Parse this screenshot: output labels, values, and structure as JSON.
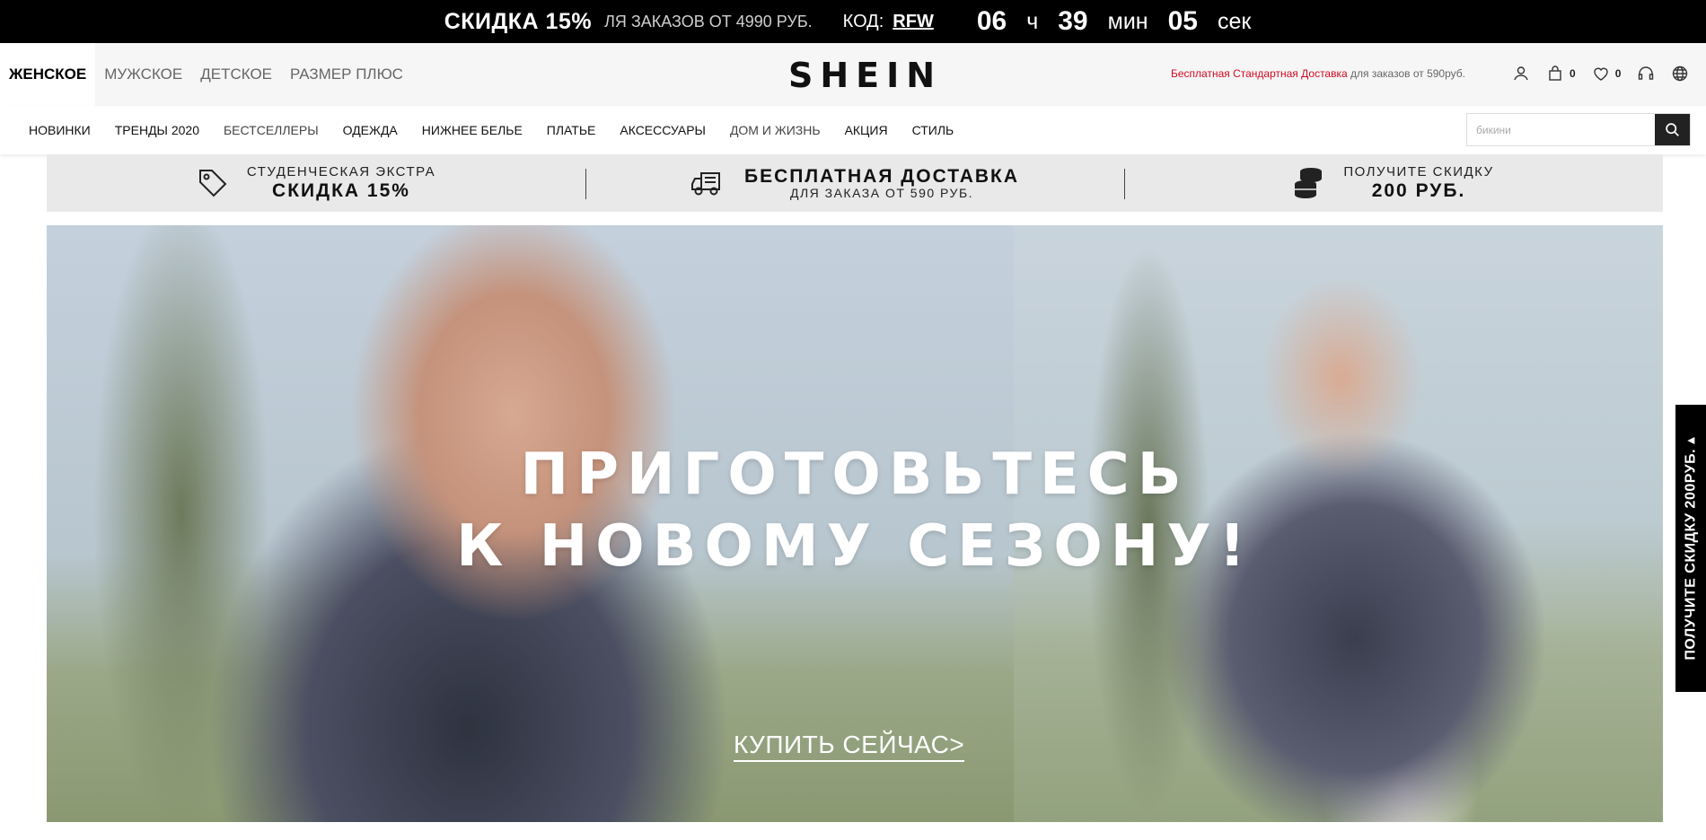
{
  "promo": {
    "discount": "СКИДКА 15%",
    "sub": "ЛЯ ЗАКАЗОВ ОТ 4990 РУБ.",
    "code_label": "КОД:",
    "code": "RFW",
    "hours": "06",
    "hours_unit": "ч",
    "minutes": "39",
    "minutes_unit": "мин",
    "seconds": "05",
    "seconds_unit": "сек"
  },
  "header": {
    "gender_tabs": [
      "ЖЕНСКОЕ",
      "МУЖСКОЕ",
      "ДЕТСКОЕ",
      "РАЗМЕР ПЛЮС"
    ],
    "logo": "SHEIN",
    "shipping_red": "Бесплатная Стандартная Доставка",
    "shipping_rest": "для заказов от 590руб.",
    "cart_count": "0",
    "wishlist_count": "0"
  },
  "nav": {
    "items": [
      "НОВИНКИ",
      "ТРЕНДЫ 2020",
      "БЕСТСЕЛЛЕРЫ",
      "ОДЕЖДА",
      "НИЖНЕЕ БЕЛЬЕ",
      "ПЛАТЬЕ",
      "АКСЕССУАРЫ",
      "ДОМ И ЖИЗНЬ",
      "АКЦИЯ",
      "СТИЛЬ"
    ],
    "search_placeholder": "бикини"
  },
  "benefits": [
    {
      "small": "СТУДЕНЧЕСКАЯ ЭКСТРА",
      "big": "СКИДКА 15%"
    },
    {
      "big": "БЕСПЛАТНАЯ ДОСТАВКА",
      "small": "ДЛЯ ЗАКАЗА ОТ 590 РУБ."
    },
    {
      "small": "ПОЛУЧИТЕ СКИДКУ",
      "big": "200 РУБ."
    }
  ],
  "hero": {
    "title_line1": "ПРИГОТОВЬТЕСЬ",
    "title_line2": "К НОВОМУ СЕЗОНУ!",
    "cta": "КУПИТЬ СЕЙЧАС>"
  },
  "side_tab": {
    "label": "ПОЛУЧИТЕ СКИДКУ 200РУБ. ▴"
  },
  "colors": {
    "accent_red": "#d20b23",
    "promo_bg": "#000000",
    "benefits_bg": "#e9e9e9"
  }
}
